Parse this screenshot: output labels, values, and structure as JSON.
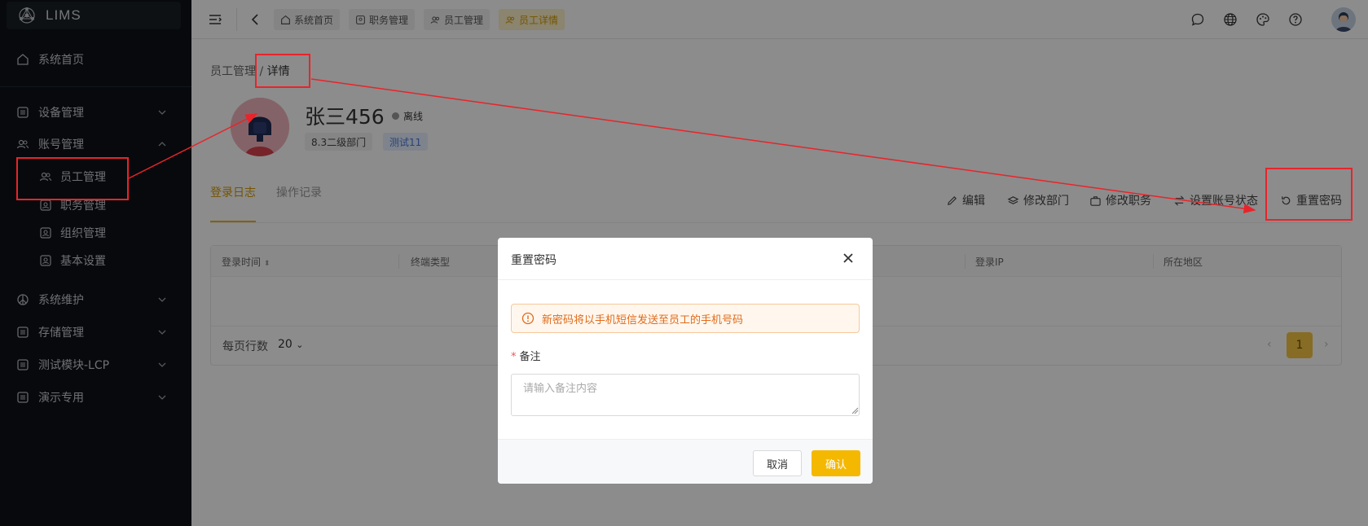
{
  "app": {
    "logo_text": "LIMS"
  },
  "sidebar": {
    "items": [
      {
        "label": "系统首页",
        "icon": "home-icon"
      },
      {
        "label": "设备管理",
        "icon": "list-icon"
      },
      {
        "label": "账号管理",
        "icon": "users-icon"
      },
      {
        "label": "员工管理",
        "icon": "users-icon"
      },
      {
        "label": "职务管理",
        "icon": "badge-icon"
      },
      {
        "label": "组织管理",
        "icon": "badge-icon"
      },
      {
        "label": "基本设置",
        "icon": "badge-icon"
      },
      {
        "label": "系统维护",
        "icon": "peace-icon"
      },
      {
        "label": "存储管理",
        "icon": "list-icon"
      },
      {
        "label": "测试模块-LCP",
        "icon": "list-icon"
      },
      {
        "label": "演示专用",
        "icon": "list-icon"
      }
    ]
  },
  "topbar": {
    "tags": [
      {
        "label": "系统首页",
        "icon": "home-icon"
      },
      {
        "label": "职务管理",
        "icon": "badge-icon"
      },
      {
        "label": "员工管理",
        "icon": "users-icon"
      },
      {
        "label": "员工详情",
        "icon": "users-icon",
        "active": true
      }
    ]
  },
  "breadcrumb": {
    "parent": "员工管理",
    "separator": " / ",
    "current": "详情"
  },
  "profile": {
    "name": "张三456",
    "status": "离线",
    "department": "8.3二级部门",
    "role": "测试11"
  },
  "tabs": [
    "登录日志",
    "操作记录"
  ],
  "actions": [
    {
      "label": "编辑",
      "icon": "pencil-icon"
    },
    {
      "label": "修改部门",
      "icon": "layers-icon"
    },
    {
      "label": "修改职务",
      "icon": "briefcase-icon"
    },
    {
      "label": "设置账号状态",
      "icon": "swap-icon"
    },
    {
      "label": "重置密码",
      "icon": "reset-icon"
    }
  ],
  "table": {
    "columns": [
      "登录时间",
      "终端类型",
      "登录IP",
      "所在地区"
    ],
    "per_page_label": "每页行数",
    "per_page_value": "20",
    "current_page": "1"
  },
  "modal": {
    "title": "重置密码",
    "alert": "新密码将以手机短信发送至员工的手机号码",
    "field_label": "备注",
    "required_mark": "*",
    "placeholder": "请输入备注内容",
    "cancel": "取消",
    "confirm": "确认"
  },
  "colors": {
    "sidebar_bg": "#0e1116",
    "accent": "#f5b800",
    "annotation": "#e8242a",
    "alert_text": "#e06b1a"
  }
}
